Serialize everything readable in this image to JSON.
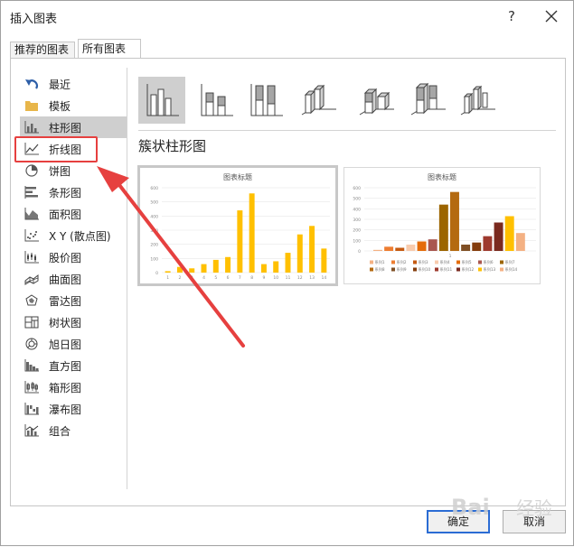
{
  "window": {
    "title": "插入图表",
    "help_label": "?"
  },
  "tabs": [
    {
      "label": "推荐的图表",
      "active": false
    },
    {
      "label": "所有图表",
      "active": true
    }
  ],
  "sidebar": {
    "items": [
      {
        "label": "最近",
        "icon": "undo-icon"
      },
      {
        "label": "模板",
        "icon": "folder-icon"
      },
      {
        "label": "柱形图",
        "icon": "column-chart-icon",
        "selected": true
      },
      {
        "label": "折线图",
        "icon": "line-chart-icon"
      },
      {
        "label": "饼图",
        "icon": "pie-chart-icon"
      },
      {
        "label": "条形图",
        "icon": "bar-chart-icon"
      },
      {
        "label": "面积图",
        "icon": "area-chart-icon"
      },
      {
        "label": "X Y (散点图)",
        "icon": "scatter-chart-icon"
      },
      {
        "label": "股价图",
        "icon": "stock-chart-icon"
      },
      {
        "label": "曲面图",
        "icon": "surface-chart-icon"
      },
      {
        "label": "雷达图",
        "icon": "radar-chart-icon"
      },
      {
        "label": "树状图",
        "icon": "treemap-chart-icon"
      },
      {
        "label": "旭日图",
        "icon": "sunburst-chart-icon"
      },
      {
        "label": "直方图",
        "icon": "histogram-chart-icon"
      },
      {
        "label": "箱形图",
        "icon": "box-chart-icon"
      },
      {
        "label": "瀑布图",
        "icon": "waterfall-chart-icon"
      },
      {
        "label": "组合",
        "icon": "combo-chart-icon"
      }
    ]
  },
  "main": {
    "heading": "簇状柱形图",
    "preview1": {
      "title": "图表标题",
      "yticks": [
        "0",
        "100",
        "200",
        "300",
        "400",
        "500",
        "600"
      ],
      "categories": [
        "1",
        "2",
        "3",
        "4",
        "5",
        "6",
        "7",
        "8",
        "9",
        "10",
        "11",
        "12",
        "13",
        "14"
      ],
      "values": [
        10,
        40,
        30,
        60,
        90,
        110,
        440,
        560,
        60,
        80,
        140,
        270,
        330,
        170
      ],
      "bar_color": "#ffc000"
    },
    "preview2": {
      "title": "图表标题",
      "yticks": [
        "0",
        "100",
        "200",
        "300",
        "400",
        "500",
        "600"
      ],
      "category": "1",
      "values": [
        10,
        40,
        30,
        60,
        90,
        110,
        440,
        560,
        60,
        80,
        140,
        270,
        330,
        170
      ],
      "colors": [
        "#f4b183",
        "#ed7d31",
        "#c55a11",
        "#f8cbad",
        "#e46c0a",
        "#a9574f",
        "#9c6500",
        "#b46a10",
        "#7f4f24",
        "#843c0c",
        "#9e3a2e",
        "#7a2a1f",
        "#ffc000",
        "#f4b183"
      ],
      "legend": [
        "系列1",
        "系列2",
        "系列3",
        "系列4",
        "系列5",
        "系列6",
        "系列7",
        "系列8",
        "系列9",
        "系列10",
        "系列11",
        "系列12",
        "系列13",
        "系列14"
      ]
    }
  },
  "buttons": {
    "ok_label": "确定",
    "cancel_label": "取消"
  },
  "watermark": {
    "text": "经验"
  }
}
